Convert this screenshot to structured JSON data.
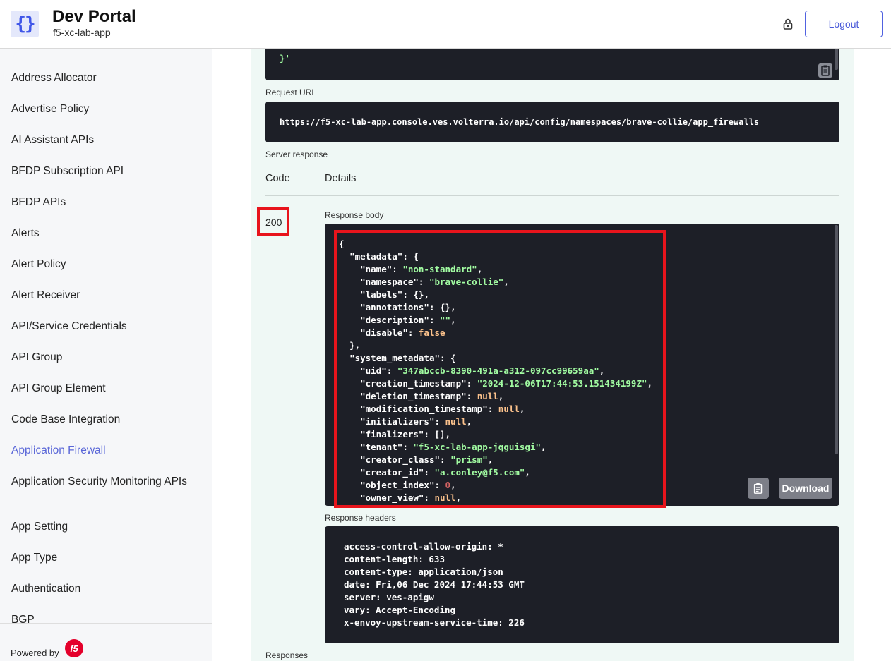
{
  "header": {
    "title": "Dev Portal",
    "subtitle": "f5-xc-lab-app",
    "logo_glyph": "{}",
    "logout_label": "Logout"
  },
  "sidebar": {
    "items": [
      {
        "label": "Address Allocator"
      },
      {
        "label": "Advertise Policy"
      },
      {
        "label": "AI Assistant APIs"
      },
      {
        "label": "BFDP Subscription API"
      },
      {
        "label": "BFDP APIs"
      },
      {
        "label": "Alerts"
      },
      {
        "label": "Alert Policy"
      },
      {
        "label": "Alert Receiver"
      },
      {
        "label": "API/Service Credentials"
      },
      {
        "label": "API Group"
      },
      {
        "label": "API Group Element"
      },
      {
        "label": "Code Base Integration"
      },
      {
        "label": "Application Firewall",
        "active": true
      },
      {
        "label": "Application Security Monitoring APIs"
      },
      {
        "label": "App Setting"
      },
      {
        "label": "App Type"
      },
      {
        "label": "Authentication"
      },
      {
        "label": "BGP"
      }
    ],
    "powered_by": "Powered by",
    "brand_glyph": "f5"
  },
  "request": {
    "body_tail_line1": "  }",
    "body_tail_line2": "}'",
    "url_label": "Request URL",
    "url": "https://f5-xc-lab-app.console.ves.volterra.io/api/config/namespaces/brave-collie/app_firewalls"
  },
  "response": {
    "section_label": "Server response",
    "col_code": "Code",
    "col_details": "Details",
    "code": "200",
    "body_label": "Response body",
    "download_label": "Download",
    "headers_label": "Response headers",
    "headers": [
      "access-control-allow-origin: *",
      "content-length: 633",
      "content-type: application/json",
      "date: Fri,06 Dec 2024 17:44:53 GMT",
      "server: ves-apigw",
      "vary: Accept-Encoding",
      "x-envoy-upstream-service-time: 226"
    ],
    "responses_label": "Responses"
  },
  "json_body": {
    "l0": "{",
    "metadata_key": "\"metadata\"",
    "name_key": "\"name\"",
    "name_val": "\"non-standard\"",
    "namespace_key": "\"namespace\"",
    "namespace_val": "\"brave-collie\"",
    "labels_key": "\"labels\"",
    "labels_val": "{},",
    "annotations_key": "\"annotations\"",
    "annotations_val": "{},",
    "description_key": "\"description\"",
    "description_val": "\"\"",
    "disable_key": "\"disable\"",
    "disable_val": "false",
    "close_meta": "},",
    "system_metadata_key": "\"system_metadata\"",
    "uid_key": "\"uid\"",
    "uid_val": "\"347abccb-8390-491a-a312-097cc99659aa\"",
    "creation_key": "\"creation_timestamp\"",
    "creation_val": "\"2024-12-06T17:44:53.151434199Z\"",
    "deletion_key": "\"deletion_timestamp\"",
    "deletion_val": "null",
    "modification_key": "\"modification_timestamp\"",
    "modification_val": "null",
    "initializers_key": "\"initializers\"",
    "initializers_val": "null",
    "finalizers_key": "\"finalizers\"",
    "finalizers_val": "[],",
    "tenant_key": "\"tenant\"",
    "tenant_val": "\"f5-xc-lab-app-jqguisgi\"",
    "creator_class_key": "\"creator_class\"",
    "creator_class_val": "\"prism\"",
    "creator_id_key": "\"creator_id\"",
    "creator_id_val": "\"a.conley@f5.com\"",
    "object_index_key": "\"object_index\"",
    "object_index_val": "0",
    "owner_view_key": "\"owner_view\"",
    "owner_view_val": "null"
  },
  "colors": {
    "accent": "#5a67d8",
    "highlight": "#e8141c",
    "code_bg": "#1d1f27",
    "op_bg": "#eff8f5"
  }
}
